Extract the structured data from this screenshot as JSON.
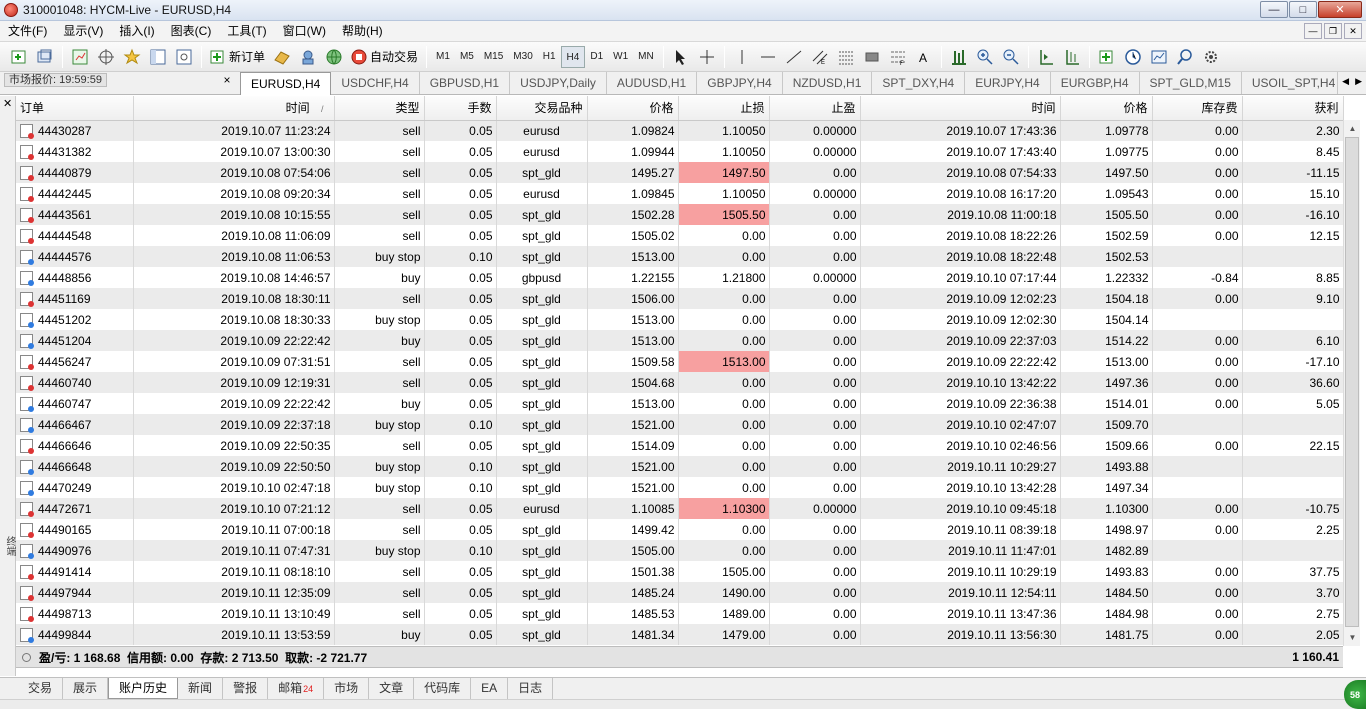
{
  "window": {
    "title": "310001048: HYCM-Live - EURUSD,H4",
    "controls": [
      "—",
      "□",
      "✕"
    ]
  },
  "menu": [
    "文件(F)",
    "显示(V)",
    "插入(I)",
    "图表(C)",
    "工具(T)",
    "窗口(W)",
    "帮助(H)"
  ],
  "toolbar": {
    "new_order_label": "新订单",
    "auto_trade_label": "自动交易",
    "timeframes": [
      "M1",
      "M5",
      "M15",
      "M30",
      "H1",
      "H4",
      "D1",
      "W1",
      "MN"
    ],
    "active_timeframe": "H4"
  },
  "market_watch": {
    "label": "市场报价: 19:59:59",
    "close": "×"
  },
  "chart_tabs": [
    "EURUSD,H4",
    "USDCHF,H4",
    "GBPUSD,H1",
    "USDJPY,Daily",
    "AUDUSD,H1",
    "GBPJPY,H4",
    "NZDUSD,H1",
    "SPT_DXY,H4",
    "EURJPY,H4",
    "EURGBP,H4",
    "SPT_GLD,M15",
    "USOIL_SPT,H4"
  ],
  "active_chart_tab": "EURUSD,H4",
  "history": {
    "columns": [
      "订单",
      "时间",
      "类型",
      "手数",
      "交易品种",
      "价格",
      "止损",
      "止盈",
      "时间",
      "价格",
      "库存费",
      "获利"
    ],
    "sort_marker": "/",
    "rows": [
      {
        "order": "44430287",
        "open_time": "2019.10.07 11:23:24",
        "type": "sell",
        "lots": "0.05",
        "symbol": "eurusd",
        "price": "1.09824",
        "sl": "1.10050",
        "tp": "0.00000",
        "close_time": "2019.10.07 17:43:36",
        "close_price": "1.09778",
        "swap": "0.00",
        "profit": "2.30",
        "sl_hit": false
      },
      {
        "order": "44431382",
        "open_time": "2019.10.07 13:00:30",
        "type": "sell",
        "lots": "0.05",
        "symbol": "eurusd",
        "price": "1.09944",
        "sl": "1.10050",
        "tp": "0.00000",
        "close_time": "2019.10.07 17:43:40",
        "close_price": "1.09775",
        "swap": "0.00",
        "profit": "8.45",
        "sl_hit": false
      },
      {
        "order": "44440879",
        "open_time": "2019.10.08 07:54:06",
        "type": "sell",
        "lots": "0.05",
        "symbol": "spt_gld",
        "price": "1495.27",
        "sl": "1497.50",
        "tp": "0.00",
        "close_time": "2019.10.08 07:54:33",
        "close_price": "1497.50",
        "swap": "0.00",
        "profit": "-11.15",
        "sl_hit": true
      },
      {
        "order": "44442445",
        "open_time": "2019.10.08 09:20:34",
        "type": "sell",
        "lots": "0.05",
        "symbol": "eurusd",
        "price": "1.09845",
        "sl": "1.10050",
        "tp": "0.00000",
        "close_time": "2019.10.08 16:17:20",
        "close_price": "1.09543",
        "swap": "0.00",
        "profit": "15.10",
        "sl_hit": false
      },
      {
        "order": "44443561",
        "open_time": "2019.10.08 10:15:55",
        "type": "sell",
        "lots": "0.05",
        "symbol": "spt_gld",
        "price": "1502.28",
        "sl": "1505.50",
        "tp": "0.00",
        "close_time": "2019.10.08 11:00:18",
        "close_price": "1505.50",
        "swap": "0.00",
        "profit": "-16.10",
        "sl_hit": true
      },
      {
        "order": "44444548",
        "open_time": "2019.10.08 11:06:09",
        "type": "sell",
        "lots": "0.05",
        "symbol": "spt_gld",
        "price": "1505.02",
        "sl": "0.00",
        "tp": "0.00",
        "close_time": "2019.10.08 18:22:26",
        "close_price": "1502.59",
        "swap": "0.00",
        "profit": "12.15",
        "sl_hit": false
      },
      {
        "order": "44444576",
        "open_time": "2019.10.08 11:06:53",
        "type": "buy stop",
        "lots": "0.10",
        "symbol": "spt_gld",
        "price": "1513.00",
        "sl": "0.00",
        "tp": "0.00",
        "close_time": "2019.10.08 18:22:48",
        "close_price": "1502.53",
        "swap": "",
        "profit": "",
        "sl_hit": false
      },
      {
        "order": "44448856",
        "open_time": "2019.10.08 14:46:57",
        "type": "buy",
        "lots": "0.05",
        "symbol": "gbpusd",
        "price": "1.22155",
        "sl": "1.21800",
        "tp": "0.00000",
        "close_time": "2019.10.10 07:17:44",
        "close_price": "1.22332",
        "swap": "-0.84",
        "profit": "8.85",
        "sl_hit": false
      },
      {
        "order": "44451169",
        "open_time": "2019.10.08 18:30:11",
        "type": "sell",
        "lots": "0.05",
        "symbol": "spt_gld",
        "price": "1506.00",
        "sl": "0.00",
        "tp": "0.00",
        "close_time": "2019.10.09 12:02:23",
        "close_price": "1504.18",
        "swap": "0.00",
        "profit": "9.10",
        "sl_hit": false
      },
      {
        "order": "44451202",
        "open_time": "2019.10.08 18:30:33",
        "type": "buy stop",
        "lots": "0.05",
        "symbol": "spt_gld",
        "price": "1513.00",
        "sl": "0.00",
        "tp": "0.00",
        "close_time": "2019.10.09 12:02:30",
        "close_price": "1504.14",
        "swap": "",
        "profit": "",
        "sl_hit": false
      },
      {
        "order": "44451204",
        "open_time": "2019.10.09 22:22:42",
        "type": "buy",
        "lots": "0.05",
        "symbol": "spt_gld",
        "price": "1513.00",
        "sl": "0.00",
        "tp": "0.00",
        "close_time": "2019.10.09 22:37:03",
        "close_price": "1514.22",
        "swap": "0.00",
        "profit": "6.10",
        "sl_hit": false
      },
      {
        "order": "44456247",
        "open_time": "2019.10.09 07:31:51",
        "type": "sell",
        "lots": "0.05",
        "symbol": "spt_gld",
        "price": "1509.58",
        "sl": "1513.00",
        "tp": "0.00",
        "close_time": "2019.10.09 22:22:42",
        "close_price": "1513.00",
        "swap": "0.00",
        "profit": "-17.10",
        "sl_hit": true
      },
      {
        "order": "44460740",
        "open_time": "2019.10.09 12:19:31",
        "type": "sell",
        "lots": "0.05",
        "symbol": "spt_gld",
        "price": "1504.68",
        "sl": "0.00",
        "tp": "0.00",
        "close_time": "2019.10.10 13:42:22",
        "close_price": "1497.36",
        "swap": "0.00",
        "profit": "36.60",
        "sl_hit": false
      },
      {
        "order": "44460747",
        "open_time": "2019.10.09 22:22:42",
        "type": "buy",
        "lots": "0.05",
        "symbol": "spt_gld",
        "price": "1513.00",
        "sl": "0.00",
        "tp": "0.00",
        "close_time": "2019.10.09 22:36:38",
        "close_price": "1514.01",
        "swap": "0.00",
        "profit": "5.05",
        "sl_hit": false
      },
      {
        "order": "44466467",
        "open_time": "2019.10.09 22:37:18",
        "type": "buy stop",
        "lots": "0.10",
        "symbol": "spt_gld",
        "price": "1521.00",
        "sl": "0.00",
        "tp": "0.00",
        "close_time": "2019.10.10 02:47:07",
        "close_price": "1509.70",
        "swap": "",
        "profit": "",
        "sl_hit": false
      },
      {
        "order": "44466646",
        "open_time": "2019.10.09 22:50:35",
        "type": "sell",
        "lots": "0.05",
        "symbol": "spt_gld",
        "price": "1514.09",
        "sl": "0.00",
        "tp": "0.00",
        "close_time": "2019.10.10 02:46:56",
        "close_price": "1509.66",
        "swap": "0.00",
        "profit": "22.15",
        "sl_hit": false
      },
      {
        "order": "44466648",
        "open_time": "2019.10.09 22:50:50",
        "type": "buy stop",
        "lots": "0.10",
        "symbol": "spt_gld",
        "price": "1521.00",
        "sl": "0.00",
        "tp": "0.00",
        "close_time": "2019.10.11 10:29:27",
        "close_price": "1493.88",
        "swap": "",
        "profit": "",
        "sl_hit": false
      },
      {
        "order": "44470249",
        "open_time": "2019.10.10 02:47:18",
        "type": "buy stop",
        "lots": "0.10",
        "symbol": "spt_gld",
        "price": "1521.00",
        "sl": "0.00",
        "tp": "0.00",
        "close_time": "2019.10.10 13:42:28",
        "close_price": "1497.34",
        "swap": "",
        "profit": "",
        "sl_hit": false
      },
      {
        "order": "44472671",
        "open_time": "2019.10.10 07:21:12",
        "type": "sell",
        "lots": "0.05",
        "symbol": "eurusd",
        "price": "1.10085",
        "sl": "1.10300",
        "tp": "0.00000",
        "close_time": "2019.10.10 09:45:18",
        "close_price": "1.10300",
        "swap": "0.00",
        "profit": "-10.75",
        "sl_hit": true
      },
      {
        "order": "44490165",
        "open_time": "2019.10.11 07:00:18",
        "type": "sell",
        "lots": "0.05",
        "symbol": "spt_gld",
        "price": "1499.42",
        "sl": "0.00",
        "tp": "0.00",
        "close_time": "2019.10.11 08:39:18",
        "close_price": "1498.97",
        "swap": "0.00",
        "profit": "2.25",
        "sl_hit": false
      },
      {
        "order": "44490976",
        "open_time": "2019.10.11 07:47:31",
        "type": "buy stop",
        "lots": "0.10",
        "symbol": "spt_gld",
        "price": "1505.00",
        "sl": "0.00",
        "tp": "0.00",
        "close_time": "2019.10.11 11:47:01",
        "close_price": "1482.89",
        "swap": "",
        "profit": "",
        "sl_hit": false
      },
      {
        "order": "44491414",
        "open_time": "2019.10.11 08:18:10",
        "type": "sell",
        "lots": "0.05",
        "symbol": "spt_gld",
        "price": "1501.38",
        "sl": "1505.00",
        "tp": "0.00",
        "close_time": "2019.10.11 10:29:19",
        "close_price": "1493.83",
        "swap": "0.00",
        "profit": "37.75",
        "sl_hit": false
      },
      {
        "order": "44497944",
        "open_time": "2019.10.11 12:35:09",
        "type": "sell",
        "lots": "0.05",
        "symbol": "spt_gld",
        "price": "1485.24",
        "sl": "1490.00",
        "tp": "0.00",
        "close_time": "2019.10.11 12:54:11",
        "close_price": "1484.50",
        "swap": "0.00",
        "profit": "3.70",
        "sl_hit": false
      },
      {
        "order": "44498713",
        "open_time": "2019.10.11 13:10:49",
        "type": "sell",
        "lots": "0.05",
        "symbol": "spt_gld",
        "price": "1485.53",
        "sl": "1489.00",
        "tp": "0.00",
        "close_time": "2019.10.11 13:47:36",
        "close_price": "1484.98",
        "swap": "0.00",
        "profit": "2.75",
        "sl_hit": false
      },
      {
        "order": "44499844",
        "open_time": "2019.10.11 13:53:59",
        "type": "buy",
        "lots": "0.05",
        "symbol": "spt_gld",
        "price": "1481.34",
        "sl": "1479.00",
        "tp": "0.00",
        "close_time": "2019.10.11 13:56:30",
        "close_price": "1481.75",
        "swap": "0.00",
        "profit": "2.05",
        "sl_hit": false
      }
    ],
    "summary": {
      "text": "盈/亏: 1 168.68  信用额: 0.00  存款: 2 713.50  取款: -2 721.77",
      "total": "1 160.41"
    }
  },
  "terminal_label": "终端",
  "bottom_tabs": [
    {
      "label": "交易",
      "badge": ""
    },
    {
      "label": "展示",
      "badge": ""
    },
    {
      "label": "账户历史",
      "badge": ""
    },
    {
      "label": "新闻",
      "badge": ""
    },
    {
      "label": "警报",
      "badge": ""
    },
    {
      "label": "邮箱",
      "badge": "24"
    },
    {
      "label": "市场",
      "badge": ""
    },
    {
      "label": "文章",
      "badge": ""
    },
    {
      "label": "代码库",
      "badge": ""
    },
    {
      "label": "EA",
      "badge": ""
    },
    {
      "label": "日志",
      "badge": ""
    }
  ],
  "active_bottom_tab": "账户历史",
  "corner_badge": "58",
  "colors": {
    "sl_highlight": "#f7a0a0",
    "row_alt": "#ebebeb",
    "sell_marker": "#d33333",
    "buy_marker": "#2f7be0"
  }
}
